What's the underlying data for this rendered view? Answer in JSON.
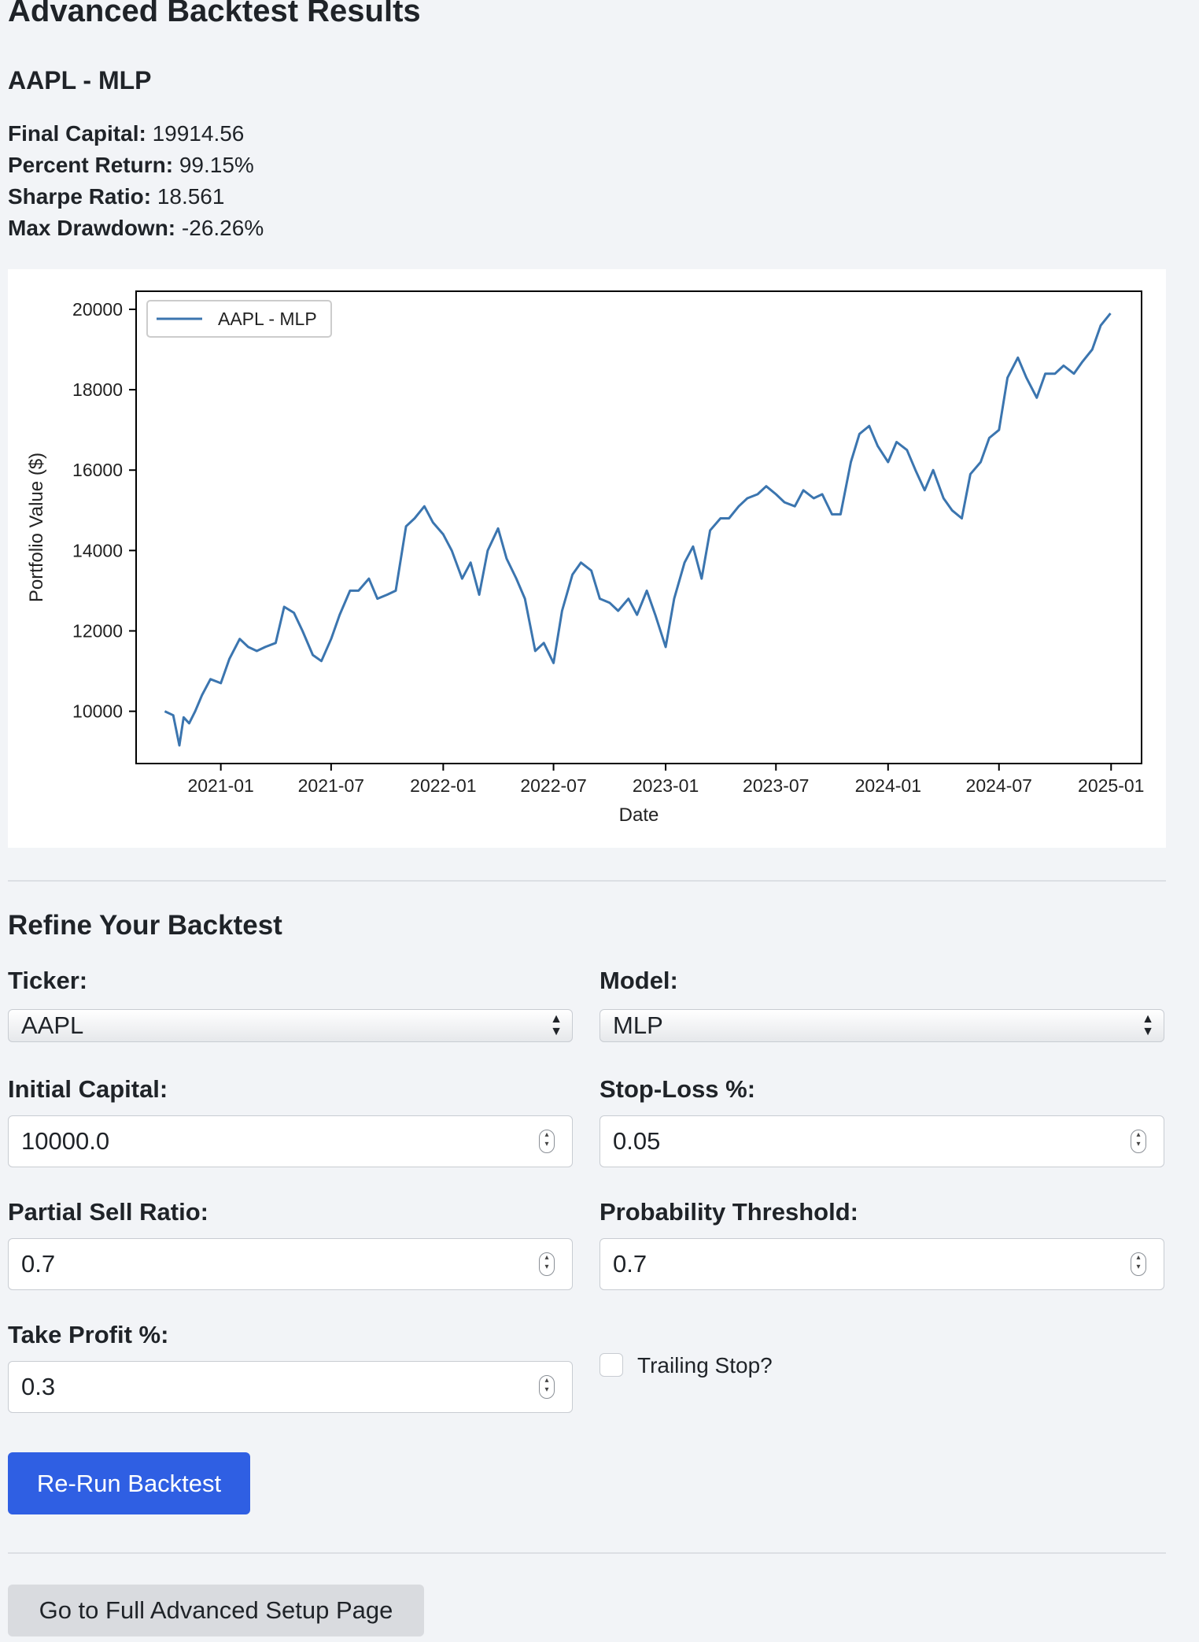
{
  "page": {
    "title": "Advanced Backtest Results"
  },
  "result": {
    "heading": "AAPL - MLP",
    "metrics": [
      {
        "label": "Final Capital:",
        "value": "19914.56"
      },
      {
        "label": "Percent Return:",
        "value": "99.15%"
      },
      {
        "label": "Sharpe Ratio:",
        "value": "18.561"
      },
      {
        "label": "Max Drawdown:",
        "value": "-26.26%"
      }
    ]
  },
  "chart_data": {
    "type": "line",
    "title": "",
    "xlabel": "Date",
    "ylabel": "Portfolio Value ($)",
    "ylim": [
      8700,
      20450
    ],
    "xlim": [
      "2020-08-15",
      "2025-02-20"
    ],
    "xticks": [
      "2021-01",
      "2021-07",
      "2022-01",
      "2022-07",
      "2023-01",
      "2023-07",
      "2024-01",
      "2024-07",
      "2025-01"
    ],
    "yticks": [
      10000,
      12000,
      14000,
      16000,
      18000,
      20000
    ],
    "legend_position": "top-left",
    "grid": false,
    "color": "#3b75af",
    "series": [
      {
        "name": "AAPL - MLP",
        "x": [
          "2020-10-01",
          "2020-10-15",
          "2020-10-25",
          "2020-11-01",
          "2020-11-10",
          "2020-11-20",
          "2020-12-01",
          "2020-12-15",
          "2021-01-01",
          "2021-01-15",
          "2021-02-01",
          "2021-02-15",
          "2021-03-01",
          "2021-03-15",
          "2021-04-01",
          "2021-04-15",
          "2021-05-01",
          "2021-05-15",
          "2021-06-01",
          "2021-06-15",
          "2021-07-01",
          "2021-07-15",
          "2021-08-01",
          "2021-08-15",
          "2021-09-01",
          "2021-09-15",
          "2021-10-01",
          "2021-10-15",
          "2021-11-01",
          "2021-11-15",
          "2021-12-01",
          "2021-12-15",
          "2022-01-01",
          "2022-01-15",
          "2022-02-01",
          "2022-02-15",
          "2022-03-01",
          "2022-03-15",
          "2022-04-01",
          "2022-04-15",
          "2022-05-01",
          "2022-05-15",
          "2022-06-01",
          "2022-06-15",
          "2022-07-01",
          "2022-07-15",
          "2022-08-01",
          "2022-08-15",
          "2022-09-01",
          "2022-09-15",
          "2022-10-01",
          "2022-10-15",
          "2022-11-01",
          "2022-11-15",
          "2022-12-01",
          "2022-12-15",
          "2023-01-01",
          "2023-01-15",
          "2023-02-01",
          "2023-02-15",
          "2023-03-01",
          "2023-03-15",
          "2023-04-01",
          "2023-04-15",
          "2023-05-01",
          "2023-05-15",
          "2023-06-01",
          "2023-06-15",
          "2023-07-01",
          "2023-07-15",
          "2023-08-01",
          "2023-08-15",
          "2023-09-01",
          "2023-09-15",
          "2023-10-01",
          "2023-10-15",
          "2023-11-01",
          "2023-11-15",
          "2023-12-01",
          "2023-12-15",
          "2024-01-01",
          "2024-01-15",
          "2024-02-01",
          "2024-02-15",
          "2024-03-01",
          "2024-03-15",
          "2024-04-01",
          "2024-04-15",
          "2024-05-01",
          "2024-05-15",
          "2024-06-01",
          "2024-06-15",
          "2024-07-01",
          "2024-07-15",
          "2024-08-01",
          "2024-08-15",
          "2024-09-01",
          "2024-09-15",
          "2024-10-01",
          "2024-10-15",
          "2024-11-01",
          "2024-11-15",
          "2024-12-01",
          "2024-12-15",
          "2024-12-31"
        ],
        "y": [
          10000,
          9900,
          9150,
          9850,
          9700,
          10000,
          10400,
          10800,
          10700,
          11300,
          11800,
          11600,
          11500,
          11600,
          11700,
          12600,
          12450,
          12000,
          11400,
          11250,
          11800,
          12400,
          13000,
          13000,
          13300,
          12800,
          12900,
          13000,
          14600,
          14800,
          15100,
          14700,
          14400,
          14000,
          13300,
          13700,
          12900,
          14000,
          14550,
          13800,
          13300,
          12800,
          11500,
          11700,
          11200,
          12500,
          13400,
          13700,
          13500,
          12800,
          12700,
          12500,
          12800,
          12400,
          13000,
          12400,
          11600,
          12800,
          13700,
          14100,
          13300,
          14500,
          14800,
          14800,
          15100,
          15300,
          15400,
          15600,
          15400,
          15200,
          15100,
          15500,
          15300,
          15400,
          14900,
          14900,
          16200,
          16900,
          17100,
          16600,
          16200,
          16700,
          16500,
          16000,
          15500,
          16000,
          15300,
          15000,
          14800,
          15900,
          16200,
          16800,
          17000,
          18300,
          18800,
          18300,
          17800,
          18400,
          18400,
          18600,
          18400,
          18700,
          19000,
          19600,
          19900
        ]
      }
    ]
  },
  "form": {
    "heading": "Refine Your Backtest",
    "ticker": {
      "label": "Ticker:",
      "value": "AAPL"
    },
    "model": {
      "label": "Model:",
      "value": "MLP"
    },
    "initial_capital": {
      "label": "Initial Capital:",
      "value": "10000.0"
    },
    "stop_loss": {
      "label": "Stop-Loss %:",
      "value": "0.05"
    },
    "partial_sell_ratio": {
      "label": "Partial Sell Ratio:",
      "value": "0.7"
    },
    "probability_threshold": {
      "label": "Probability Threshold:",
      "value": "0.7"
    },
    "take_profit": {
      "label": "Take Profit %:",
      "value": "0.3"
    },
    "trailing_stop": {
      "label": "Trailing Stop?",
      "checked": false
    },
    "submit_label": "Re-Run Backtest"
  },
  "footer": {
    "setup_link_label": "Go to Full Advanced Setup Page"
  }
}
